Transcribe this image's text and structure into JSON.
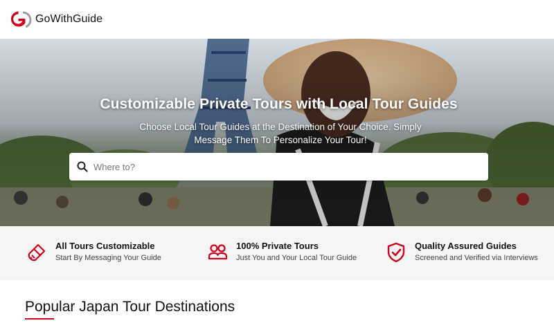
{
  "header": {
    "brand": "GoWithGuide",
    "logo_icon": "gowithguide-logo-icon",
    "accent": "#d0021b"
  },
  "hero": {
    "title": "Customizable Private Tours with Local Tour Guides",
    "subtitle": "Choose Local Tour Guides at the Destination of Your Choice. Simply Message Them To Personalize Your Tour!",
    "search": {
      "icon": "search-icon",
      "placeholder": "Where to?",
      "value": ""
    }
  },
  "features": [
    {
      "icon": "brush-icon",
      "title": "All Tours Customizable",
      "desc": "Start By Messaging Your Guide"
    },
    {
      "icon": "people-icon",
      "title": "100% Private Tours",
      "desc": "Just You and Your Local Tour Guide"
    },
    {
      "icon": "shield-check-icon",
      "title": "Quality Assured Guides",
      "desc": "Screened and Verified via Interviews"
    }
  ],
  "section": {
    "title": "Popular Japan Tour Destinations"
  }
}
